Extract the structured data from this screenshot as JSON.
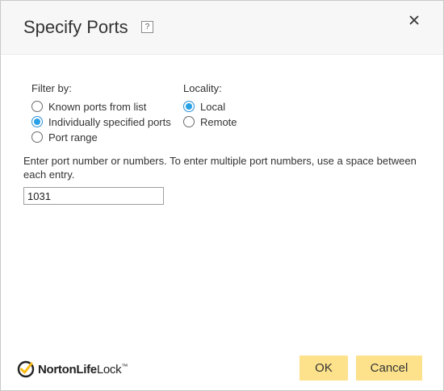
{
  "dialog": {
    "title": "Specify Ports",
    "help_glyph": "?",
    "close_icon": "close-icon"
  },
  "filter": {
    "label": "Filter by:",
    "options": [
      {
        "label": "Known ports from list",
        "checked": false
      },
      {
        "label": "Individually specified ports",
        "checked": true
      },
      {
        "label": "Port range",
        "checked": false
      }
    ]
  },
  "locality": {
    "label": "Locality:",
    "options": [
      {
        "label": "Local",
        "checked": true
      },
      {
        "label": "Remote",
        "checked": false
      }
    ]
  },
  "instructions": "Enter port number or numbers. To enter multiple port numbers, use a space between each entry.",
  "port_input": {
    "value": "1031"
  },
  "brand": {
    "name_bold": "NortonLife",
    "name_regular": "Lock",
    "trademark": "™",
    "accent": "#fdbb11"
  },
  "buttons": {
    "ok": "OK",
    "cancel": "Cancel",
    "color": "#fde28b"
  }
}
